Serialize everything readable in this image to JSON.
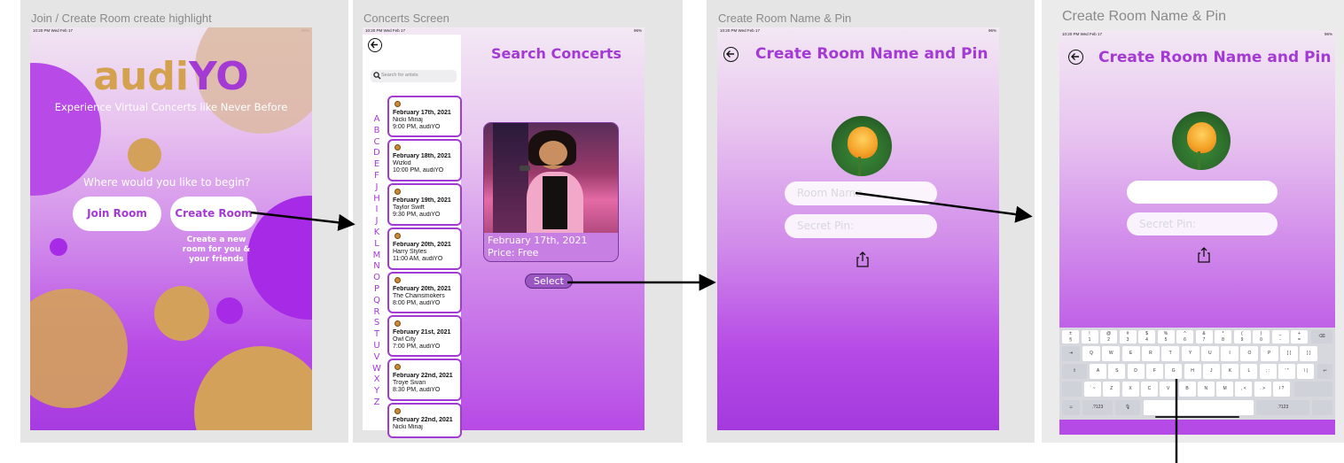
{
  "colors": {
    "brand_purple": "#a43ad4",
    "logo_gold": "#d4a14e"
  },
  "status_bar": {
    "time": "10:20 PM  Wed Feb 17",
    "battery": "96%"
  },
  "panel1": {
    "title": "Join / Create Room create highlight",
    "logo_part1": "audi",
    "logo_part2": "YO",
    "tagline": "Experience Virtual Concerts like Never Before",
    "prompt": "Where would you like to begin?",
    "join_button": "Join Room",
    "create_button": "Create Room",
    "create_hint_lines": [
      "Create a new",
      "room for you &",
      "your friends"
    ]
  },
  "panel2": {
    "title": "Concerts Screen",
    "back_icon": "back-arrow-icon",
    "search_placeholder": "Search for artists",
    "heading": "Search Concerts",
    "alphabet": [
      "A",
      "B",
      "C",
      "D",
      "E",
      "F",
      "J",
      "H",
      "I",
      "J",
      "K",
      "L",
      "M",
      "N",
      "O",
      "P",
      "Q",
      "R",
      "S",
      "T",
      "U",
      "V",
      "W",
      "X",
      "Y",
      "Z"
    ],
    "concerts": [
      {
        "date": "February 17th, 2021",
        "artist": "Nicki Minaj",
        "time": "9:00 PM, audiYO"
      },
      {
        "date": "February 18th, 2021",
        "artist": "Wizkid",
        "time": "10:00 PM, audiYO"
      },
      {
        "date": "February 19th, 2021",
        "artist": "Taylor Swift",
        "time": "9:30 PM, audiYO"
      },
      {
        "date": "February 20th, 2021",
        "artist": "Harry Styles",
        "time": "11:00 AM, audiYO"
      },
      {
        "date": "February 20th, 2021",
        "artist": "The Chainsmokers",
        "time": "8:00 PM, audiYO"
      },
      {
        "date": "February 21st, 2021",
        "artist": "Owl City",
        "time": "7:00 PM, audiYO"
      },
      {
        "date": "February 22nd, 2021",
        "artist": "Troye Sivan",
        "time": "8:30 PM, audiYO"
      },
      {
        "date": "February 22nd, 2021",
        "artist": "Nicki Minaj",
        "time": ""
      }
    ],
    "selected_date": "February 17th, 2021",
    "selected_price": "Price: Free",
    "select_button": "Select"
  },
  "panel3": {
    "title": "Create Room Name & Pin",
    "heading": "Create Room Name and Pin",
    "room_name_placeholder": "Room Name",
    "secret_pin_placeholder": "Secret Pin:"
  },
  "panel4": {
    "title": "Create Room Name & Pin",
    "heading": "Create Room Name and Pin",
    "room_name_value": "",
    "secret_pin_placeholder": "Secret Pin:",
    "keyboard": {
      "row0": [
        [
          "±",
          "§"
        ],
        [
          "!",
          "1"
        ],
        [
          "@",
          "2"
        ],
        [
          "#",
          "3"
        ],
        [
          "$",
          "4"
        ],
        [
          "%",
          "5"
        ],
        [
          "^",
          "6"
        ],
        [
          "&",
          "7"
        ],
        [
          "*",
          "8"
        ],
        [
          "(",
          "9"
        ],
        [
          ")",
          "0"
        ],
        [
          "_",
          "-"
        ],
        [
          "+",
          "="
        ]
      ],
      "row1": [
        "Q",
        "W",
        "E",
        "R",
        "T",
        "Y",
        "U",
        "I",
        "O",
        "P",
        "[ {",
        "] }"
      ],
      "row2": [
        "A",
        "S",
        "D",
        "F",
        "G",
        "H",
        "J",
        "K",
        "L",
        "; :",
        "' \"",
        "\\ |"
      ],
      "row3": [
        "` ~",
        "Z",
        "X",
        "C",
        "V",
        "B",
        "N",
        "M",
        ", <",
        ". >",
        "/ ?"
      ],
      "tab_label": "⇥",
      "shift_label": "⇧",
      "delete_label": "⌫",
      "return_label": "↩",
      "numbers_label": ".?123",
      "emoji_label": "☺",
      "mic_label": "🎙"
    }
  }
}
